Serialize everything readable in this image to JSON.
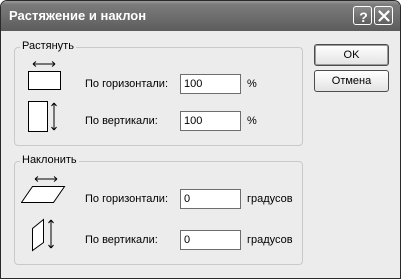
{
  "window": {
    "title": "Растяжение и наклон",
    "help_icon": "question-mark-icon",
    "close_icon": "close-icon"
  },
  "stretch": {
    "legend": "Растянуть",
    "horizontal_label": "По горизонтали:",
    "horizontal_value": "100",
    "horizontal_unit": "%",
    "vertical_label": "По вертикали:",
    "vertical_value": "100",
    "vertical_unit": "%"
  },
  "skew": {
    "legend": "Наклонить",
    "horizontal_label": "По горизонтали:",
    "horizontal_value": "0",
    "horizontal_unit": "градусов",
    "vertical_label": "По вертикали:",
    "vertical_value": "0",
    "vertical_unit": "градусов"
  },
  "buttons": {
    "ok": "OK",
    "cancel": "Отмена"
  }
}
